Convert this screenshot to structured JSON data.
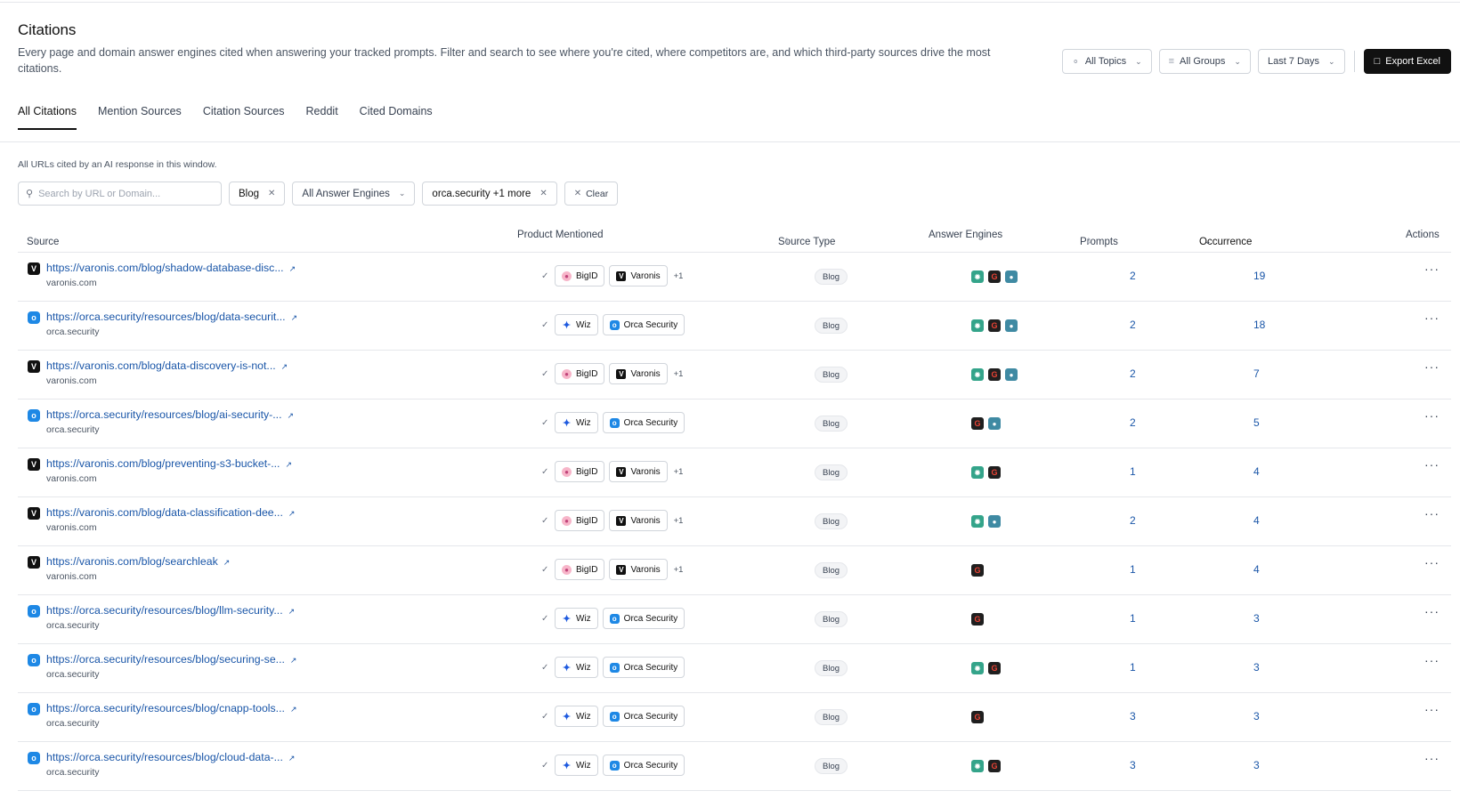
{
  "header": {
    "title": "Citations",
    "description": "Every page and domain answer engines cited when answering your tracked prompts. Filter and search to see where you're cited, where competitors are, and which third-party sources drive the most citations."
  },
  "controls": {
    "topics": "All Topics",
    "groups": "All Groups",
    "period": "Last 7 Days",
    "export": "Export Excel"
  },
  "tabs": [
    "All Citations",
    "Mention Sources",
    "Citation Sources",
    "Reddit",
    "Cited Domains"
  ],
  "subtext": "All URLs cited by an AI response in this window.",
  "filters": {
    "search_placeholder": "Search by URL or Domain...",
    "type_chip": "Blog",
    "engines_chip": "All Answer Engines",
    "domain_chip": "orca.security +1 more",
    "clear": "Clear"
  },
  "columns": {
    "source": "Source",
    "product": "Product Mentioned",
    "source_type": "Source Type",
    "engines": "Answer Engines",
    "prompts": "Prompts",
    "occurrence": "Occurrence",
    "actions": "Actions"
  },
  "rows": [
    {
      "url": "https://varonis.com/blog/shadow-database-disc...",
      "domain": "varonis.com",
      "fav": "v",
      "products": [
        "BigID",
        "Varonis"
      ],
      "more": "+1",
      "type": "Blog",
      "engines": [
        "gpt",
        "goo",
        "cop"
      ],
      "prompts": "2",
      "occurrence": "19"
    },
    {
      "url": "https://orca.security/resources/blog/data-securit...",
      "domain": "orca.security",
      "fav": "o",
      "products": [
        "Wiz",
        "Orca Security"
      ],
      "more": "",
      "type": "Blog",
      "engines": [
        "gpt",
        "goo",
        "cop"
      ],
      "prompts": "2",
      "occurrence": "18"
    },
    {
      "url": "https://varonis.com/blog/data-discovery-is-not...",
      "domain": "varonis.com",
      "fav": "v",
      "products": [
        "BigID",
        "Varonis"
      ],
      "more": "+1",
      "type": "Blog",
      "engines": [
        "gpt",
        "goo",
        "cop"
      ],
      "prompts": "2",
      "occurrence": "7"
    },
    {
      "url": "https://orca.security/resources/blog/ai-security-...",
      "domain": "orca.security",
      "fav": "o",
      "products": [
        "Wiz",
        "Orca Security"
      ],
      "more": "",
      "type": "Blog",
      "engines": [
        "goo",
        "cop"
      ],
      "prompts": "2",
      "occurrence": "5"
    },
    {
      "url": "https://varonis.com/blog/preventing-s3-bucket-...",
      "domain": "varonis.com",
      "fav": "v",
      "products": [
        "BigID",
        "Varonis"
      ],
      "more": "+1",
      "type": "Blog",
      "engines": [
        "gpt",
        "goo"
      ],
      "prompts": "1",
      "occurrence": "4"
    },
    {
      "url": "https://varonis.com/blog/data-classification-dee...",
      "domain": "varonis.com",
      "fav": "v",
      "products": [
        "BigID",
        "Varonis"
      ],
      "more": "+1",
      "type": "Blog",
      "engines": [
        "gpt",
        "cop"
      ],
      "prompts": "2",
      "occurrence": "4"
    },
    {
      "url": "https://varonis.com/blog/searchleak",
      "domain": "varonis.com",
      "fav": "v",
      "products": [
        "BigID",
        "Varonis"
      ],
      "more": "+1",
      "type": "Blog",
      "engines": [
        "goo"
      ],
      "prompts": "1",
      "occurrence": "4"
    },
    {
      "url": "https://orca.security/resources/blog/llm-security...",
      "domain": "orca.security",
      "fav": "o",
      "products": [
        "Wiz",
        "Orca Security"
      ],
      "more": "",
      "type": "Blog",
      "engines": [
        "goo"
      ],
      "prompts": "1",
      "occurrence": "3"
    },
    {
      "url": "https://orca.security/resources/blog/securing-se...",
      "domain": "orca.security",
      "fav": "o",
      "products": [
        "Wiz",
        "Orca Security"
      ],
      "more": "",
      "type": "Blog",
      "engines": [
        "gpt",
        "goo"
      ],
      "prompts": "1",
      "occurrence": "3"
    },
    {
      "url": "https://orca.security/resources/blog/cnapp-tools...",
      "domain": "orca.security",
      "fav": "o",
      "products": [
        "Wiz",
        "Orca Security"
      ],
      "more": "",
      "type": "Blog",
      "engines": [
        "goo"
      ],
      "prompts": "3",
      "occurrence": "3"
    },
    {
      "url": "https://orca.security/resources/blog/cloud-data-...",
      "domain": "orca.security",
      "fav": "o",
      "products": [
        "Wiz",
        "Orca Security"
      ],
      "more": "",
      "type": "Blog",
      "engines": [
        "gpt",
        "goo"
      ],
      "prompts": "3",
      "occurrence": "3"
    }
  ]
}
